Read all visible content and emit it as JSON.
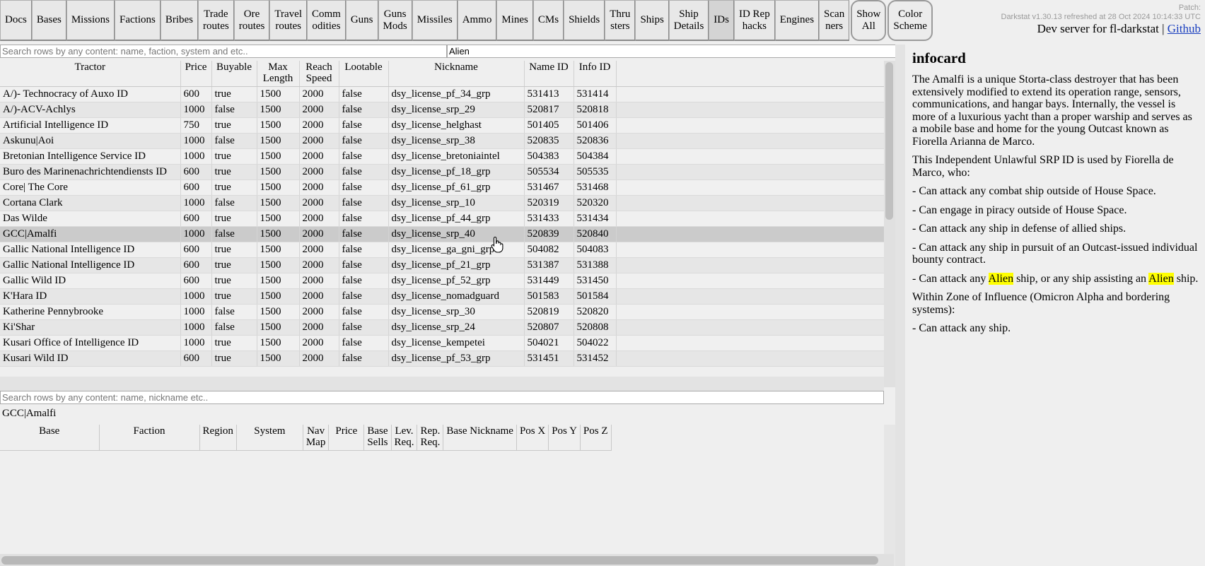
{
  "nav": {
    "items": [
      {
        "label": "Docs",
        "name": "docs"
      },
      {
        "label": "Bases",
        "name": "bases"
      },
      {
        "label": "Missions",
        "name": "missions"
      },
      {
        "label": "Factions",
        "name": "factions"
      },
      {
        "label": "Bribes",
        "name": "bribes"
      },
      {
        "label": "Trade\nroutes",
        "name": "trade-routes"
      },
      {
        "label": "Ore\nroutes",
        "name": "ore-routes"
      },
      {
        "label": "Travel\nroutes",
        "name": "travel-routes"
      },
      {
        "label": "Comm\nodities",
        "name": "commodities"
      },
      {
        "label": "Guns",
        "name": "guns"
      },
      {
        "label": "Guns\nMods",
        "name": "guns-mods"
      },
      {
        "label": "Missiles",
        "name": "missiles"
      },
      {
        "label": "Ammo",
        "name": "ammo"
      },
      {
        "label": "Mines",
        "name": "mines"
      },
      {
        "label": "CMs",
        "name": "cms"
      },
      {
        "label": "Shields",
        "name": "shields"
      },
      {
        "label": "Thru\nsters",
        "name": "thrusters"
      },
      {
        "label": "Ships",
        "name": "ships"
      },
      {
        "label": "Ship\nDetails",
        "name": "ship-details"
      },
      {
        "label": "IDs",
        "name": "ids",
        "active": true
      },
      {
        "label": "ID Rep\nhacks",
        "name": "id-rep-hacks"
      },
      {
        "label": "Engines",
        "name": "engines"
      },
      {
        "label": "Scan\nners",
        "name": "scanners"
      },
      {
        "label": "Show\nAll",
        "name": "show-all",
        "rounded": true
      },
      {
        "label": "Color\nScheme",
        "name": "color-scheme",
        "rounded": true
      }
    ]
  },
  "header": {
    "patch_label": "Patch:",
    "version_text": "Darkstat v1.30.13 refreshed at 28 Oct 2024 10:14:33 UTC",
    "dev_text": "Dev server for fl-darkstat",
    "separator": "|",
    "github_label": "Github"
  },
  "search": {
    "placeholder": "Search rows by any content: name, faction, system and etc..",
    "value": "",
    "filter_value": "Alien"
  },
  "main_table": {
    "columns": [
      "Tractor",
      "Price",
      "Buyable",
      "Max\nLength",
      "Reach\nSpeed",
      "Lootable",
      "Nickname",
      "Name ID",
      "Info ID",
      ""
    ],
    "rows": [
      [
        "A/)- Technocracy of Auxo ID",
        "600",
        "true",
        "1500",
        "2000",
        "false",
        "dsy_license_pf_34_grp",
        "531413",
        "531414"
      ],
      [
        "A/)-ACV-Achlys",
        "1000",
        "false",
        "1500",
        "2000",
        "false",
        "dsy_license_srp_29",
        "520817",
        "520818"
      ],
      [
        "Artificial Intelligence ID",
        "750",
        "true",
        "1500",
        "2000",
        "false",
        "dsy_license_helghast",
        "501405",
        "501406"
      ],
      [
        "Askunu|Aoi",
        "1000",
        "false",
        "1500",
        "2000",
        "false",
        "dsy_license_srp_38",
        "520835",
        "520836"
      ],
      [
        "Bretonian Intelligence Service ID",
        "1000",
        "true",
        "1500",
        "2000",
        "false",
        "dsy_license_bretoniaintel",
        "504383",
        "504384"
      ],
      [
        "Buro des Marinenachrichtendiensts ID",
        "600",
        "true",
        "1500",
        "2000",
        "false",
        "dsy_license_pf_18_grp",
        "505534",
        "505535"
      ],
      [
        "Core| The Core",
        "600",
        "true",
        "1500",
        "2000",
        "false",
        "dsy_license_pf_61_grp",
        "531467",
        "531468"
      ],
      [
        "Cortana Clark",
        "1000",
        "false",
        "1500",
        "2000",
        "false",
        "dsy_license_srp_10",
        "520319",
        "520320"
      ],
      [
        "Das Wilde",
        "600",
        "true",
        "1500",
        "2000",
        "false",
        "dsy_license_pf_44_grp",
        "531433",
        "531434"
      ],
      [
        "GCC|Amalfi",
        "1000",
        "false",
        "1500",
        "2000",
        "false",
        "dsy_license_srp_40",
        "520839",
        "520840"
      ],
      [
        "Gallic National Intelligence ID",
        "600",
        "true",
        "1500",
        "2000",
        "false",
        "dsy_license_ga_gni_grp",
        "504082",
        "504083"
      ],
      [
        "Gallic National Intelligence ID",
        "600",
        "true",
        "1500",
        "2000",
        "false",
        "dsy_license_pf_21_grp",
        "531387",
        "531388"
      ],
      [
        "Gallic Wild ID",
        "600",
        "true",
        "1500",
        "2000",
        "false",
        "dsy_license_pf_52_grp",
        "531449",
        "531450"
      ],
      [
        "K'Hara ID",
        "1000",
        "true",
        "1500",
        "2000",
        "false",
        "dsy_license_nomadguard",
        "501583",
        "501584"
      ],
      [
        "Katherine Pennybrooke",
        "1000",
        "false",
        "1500",
        "2000",
        "false",
        "dsy_license_srp_30",
        "520819",
        "520820"
      ],
      [
        "Ki'Shar",
        "1000",
        "false",
        "1500",
        "2000",
        "false",
        "dsy_license_srp_24",
        "520807",
        "520808"
      ],
      [
        "Kusari Office of Intelligence ID",
        "1000",
        "true",
        "1500",
        "2000",
        "false",
        "dsy_license_kempetei",
        "504021",
        "504022"
      ],
      [
        "Kusari Wild ID",
        "600",
        "true",
        "1500",
        "2000",
        "false",
        "dsy_license_pf_53_grp",
        "531451",
        "531452"
      ]
    ],
    "selected_row": 9
  },
  "bottom": {
    "search_placeholder": "Search rows by any content: name, nickname etc..",
    "search_value": "",
    "selected_title": "GCC|Amalfi",
    "columns": [
      "Base",
      "Faction",
      "Region",
      "System",
      "Nav\nMap",
      "Price",
      "Base\nSells",
      "Lev.\nReq.",
      "Rep.\nReq.",
      "Base Nickname",
      "Pos X",
      "Pos Y",
      "Pos Z"
    ]
  },
  "infocard": {
    "title": "infocard",
    "p1": "The Amalfi is a unique Storta-class destroyer that has been extensively modified to extend its operation range, sensors, communications, and hangar bays. Internally, the vessel is more of a luxurious yacht than a proper warship and serves as a mobile base and home for the young Outcast known as Fiorella Arianna de Marco.",
    "p2": "This Independent Unlawful SRP ID is used by Fiorella de Marco, who:",
    "p3": "- Can attack any combat ship outside of House Space.",
    "p4": "- Can engage in piracy outside of House Space.",
    "p5": "- Can attack any ship in defense of allied ships.",
    "p6": "- Can attack any ship in pursuit of an Outcast-issued individual bounty contract.",
    "p7_a": "- Can attack any ",
    "p7_hl1": "Alien",
    "p7_b": " ship, or any ship assisting an ",
    "p7_hl2": "Alien",
    "p7_c": " ship.",
    "p8": "Within Zone of Influence (Omicron Alpha and bordering systems):",
    "p9": "- Can attack any ship."
  },
  "colors": {
    "highlight": "#ffff00",
    "selected_row": "#cbcbcb",
    "link": "#1a3fbf"
  }
}
